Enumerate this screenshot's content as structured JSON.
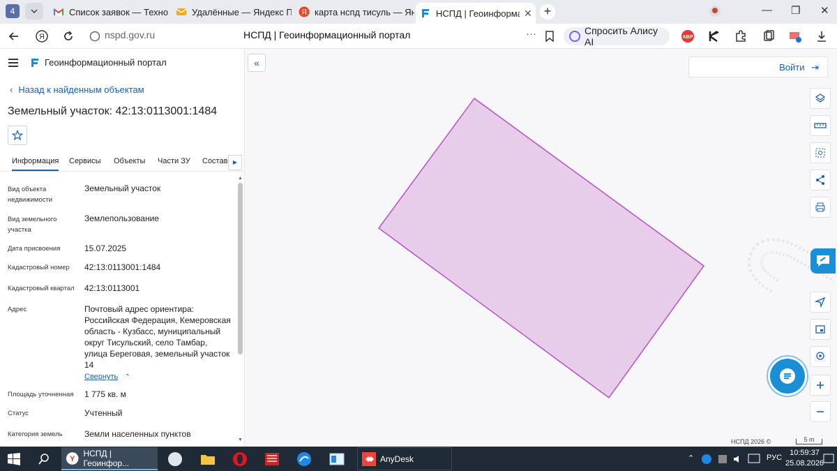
{
  "browser": {
    "tab_count": "4",
    "tabs": [
      {
        "title": "Список заявок — ТехноКа",
        "icon": "gmail-icon",
        "color": "#1a73e8"
      },
      {
        "title": "Удалённые — Яндекс Почта",
        "icon": "yandex-mail-icon",
        "color": "#f5a623"
      },
      {
        "title": "карта нспд тисуль — Яндекс",
        "icon": "yandex-icon",
        "color": "#fc3f1d"
      },
      {
        "title": "НСПД | Геоинформационный портал",
        "icon": "nspd-icon",
        "color": "#1a8fd6",
        "active": true
      }
    ],
    "new_tab": "+",
    "url": "nspd.gov.ru",
    "page_title": "НСПД | Геоинформационный портал",
    "alice_button": "Спросить Алису AI",
    "window_controls": [
      "—",
      "❐",
      "✕"
    ]
  },
  "panel": {
    "portal_name": "Геоинформационный портал",
    "back_link": "Назад к найденным объектам",
    "object_title": "Земельный участок: 42:13:0113001:1484",
    "tabs": [
      "Информация",
      "Сервисы",
      "Объекты",
      "Части ЗУ",
      "Состав"
    ],
    "fields": [
      {
        "label": "Вид объекта недвижимости",
        "value": "Земельный участок"
      },
      {
        "label": "Вид земельного участка",
        "value": "Землепользование"
      },
      {
        "label": "Дата присвоения",
        "value": "15.07.2025"
      },
      {
        "label": "Кадастровый номер",
        "value": "42:13:0113001:1484"
      },
      {
        "label": "Кадастровый квартал",
        "value": "42:13:0113001"
      },
      {
        "label": "Адрес",
        "value": "Почтовый адрес ориентира: Российская Федерация, Кемеровская область - Кузбасс, муниципальный округ Тисульский, село Тамбар, улица Береговая, земельный участок 14"
      },
      {
        "label": "Площадь уточненная",
        "value": "1 775 кв. м"
      },
      {
        "label": "Статус",
        "value": "Учтенный"
      },
      {
        "label": "Категория земель",
        "value": "Земли населенных пунктов"
      }
    ],
    "collapse_link": "Свернуть"
  },
  "map": {
    "login": "Войти",
    "attribution": "НСПД 2026 ©",
    "scale_label": "5 m",
    "parcel_fill": "#e8cdea",
    "parcel_stroke": "#b54fc9",
    "tools": [
      "layers-icon",
      "ruler-icon",
      "select-area-icon",
      "share-icon",
      "print-icon",
      "feedback-icon",
      "locate-icon",
      "basemap-icon",
      "geolocation-icon",
      "zoom-in-icon",
      "zoom-out-icon"
    ]
  },
  "taskbar": {
    "apps": [
      {
        "label": "НСПД | Геоинфор...",
        "active": true
      },
      {
        "label": "AnyDesk",
        "active": false
      }
    ],
    "lang": "РУС",
    "time": "10:59:37",
    "date": "25.08.2026"
  }
}
